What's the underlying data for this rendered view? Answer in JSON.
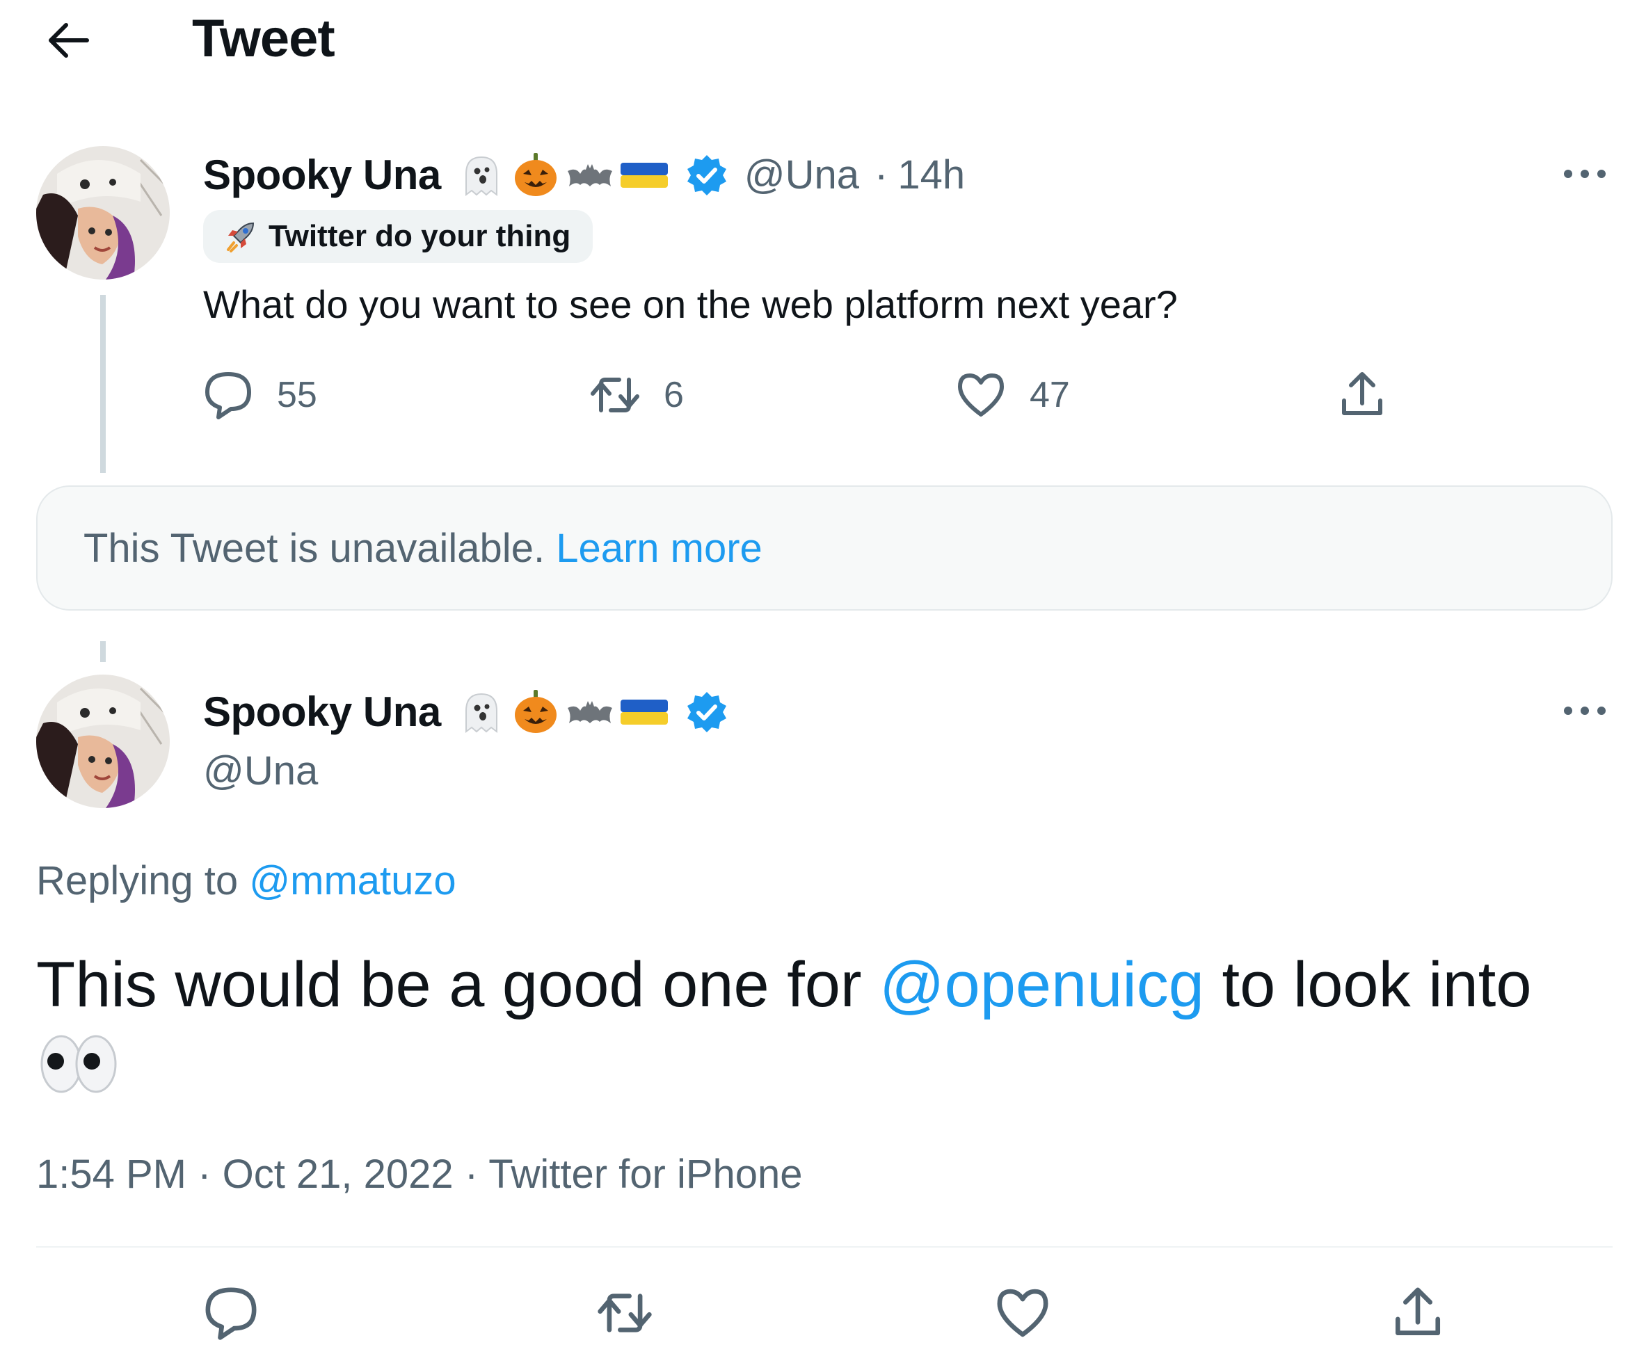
{
  "header": {
    "title": "Tweet",
    "back_icon": "arrow-left-icon"
  },
  "parent_tweet": {
    "name": "Spooky Una",
    "name_emoji": [
      "ghost-emoji",
      "jack-o-lantern-emoji",
      "bat-emoji",
      "ukraine-flag-emoji"
    ],
    "verified_icon": "verified-badge-icon",
    "handle": "@Una",
    "separator": "·",
    "time": "14h",
    "label_text": "Twitter do your thing",
    "label_icon": "rocket-icon",
    "text": "What do you want to see on the web platform next year?",
    "replies": "55",
    "retweets": "6",
    "likes": "47"
  },
  "unavailable_notice": {
    "text": "This Tweet is unavailable.",
    "link": "Learn more"
  },
  "main_tweet": {
    "name": "Spooky Una",
    "handle": "@Una",
    "replying_prefix": "Replying to",
    "replying_to": "@mmatuzo",
    "text_before": "This would be a good one for",
    "mention": "@openuicg",
    "text_after": "to look into",
    "trailing_emoji": "eyes-emoji",
    "time": "1:54 PM",
    "separator": "·",
    "date": "Oct 21, 2022",
    "source": "Twitter for iPhone"
  },
  "colors": {
    "accent": "#1d9bf0",
    "secondary_text": "#536471",
    "primary_text": "#0f1419"
  }
}
